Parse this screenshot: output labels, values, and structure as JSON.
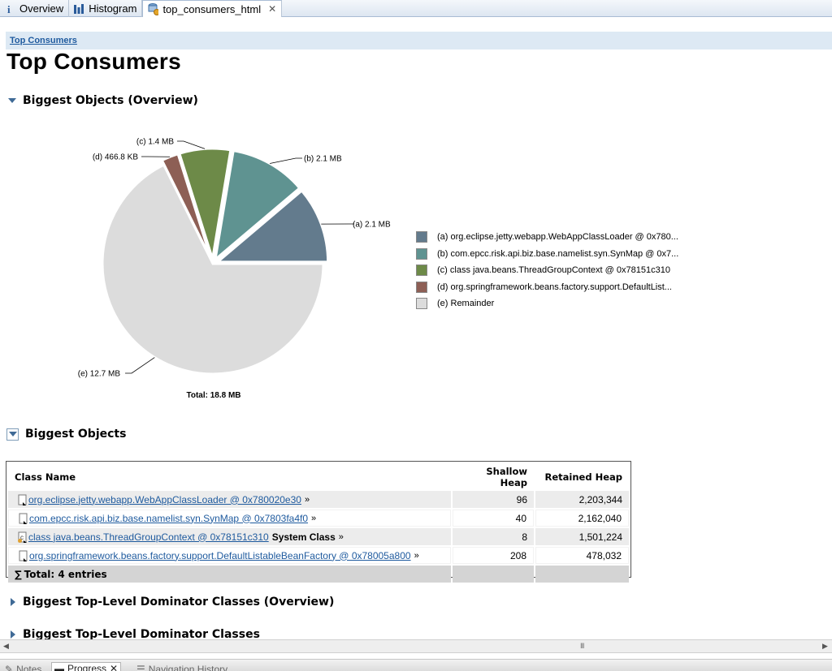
{
  "tabs": [
    {
      "label": "Overview",
      "icon": "info-icon"
    },
    {
      "label": "Histogram",
      "icon": "histogram-icon"
    },
    {
      "label": "top_consumers_html",
      "icon": "report-icon"
    }
  ],
  "breadcrumb": "Top Consumers",
  "page_title": "Top Consumers",
  "sections": {
    "overview_title": "Biggest Objects (Overview)",
    "objects_title": "Biggest Objects",
    "dominator_overview_title": "Biggest Top-Level Dominator Classes (Overview)",
    "dominator_title": "Biggest Top-Level Dominator Classes"
  },
  "chart_data": {
    "type": "pie",
    "title": "",
    "total_label": "Total: 18.8 MB",
    "slices": [
      {
        "key": "(a)",
        "label": "(a)  2.1 MB",
        "value": 2.1,
        "unit": "MB",
        "color": "#637b8d",
        "legend": "(a)  org.eclipse.jetty.webapp.WebAppClassLoader @ 0x780..."
      },
      {
        "key": "(b)",
        "label": "(b)  2.1 MB",
        "value": 2.1,
        "unit": "MB",
        "color": "#5f9391",
        "legend": "(b)  com.epcc.risk.api.biz.base.namelist.syn.SynMap @ 0x7..."
      },
      {
        "key": "(c)",
        "label": "(c)  1.4 MB",
        "value": 1.4,
        "unit": "MB",
        "color": "#6d8a48",
        "legend": "(c)  class java.beans.ThreadGroupContext @ 0x78151c310"
      },
      {
        "key": "(d)",
        "label": "(d)  466.8 KB",
        "value": 0.4668,
        "unit": "MB",
        "color": "#8d5f55",
        "legend": "(d)  org.springframework.beans.factory.support.DefaultList..."
      },
      {
        "key": "(e)",
        "label": "(e)  12.7 MB",
        "value": 12.7,
        "unit": "MB",
        "color": "#dcdcdc",
        "legend": "(e)  Remainder"
      }
    ]
  },
  "table": {
    "headers": {
      "class_name": "Class Name",
      "shallow": "Shallow Heap",
      "retained": "Retained Heap"
    },
    "rows": [
      {
        "name": "org.eclipse.jetty.webapp.WebAppClassLoader @ 0x780020e30",
        "suffix": "",
        "shallow": "96",
        "retained": "2,203,344",
        "icon": "object-icon"
      },
      {
        "name": "com.epcc.risk.api.biz.base.namelist.syn.SynMap @ 0x7803fa4f0",
        "suffix": "",
        "shallow": "40",
        "retained": "2,162,040",
        "icon": "object-icon"
      },
      {
        "name": "class java.beans.ThreadGroupContext @ 0x78151c310",
        "suffix": "System Class",
        "shallow": "8",
        "retained": "1,501,224",
        "icon": "class-icon"
      },
      {
        "name": "org.springframework.beans.factory.support.DefaultListableBeanFactory @ 0x78005a800",
        "suffix": "",
        "shallow": "208",
        "retained": "478,032",
        "icon": "object-icon"
      }
    ],
    "total": "Total: 4 entries",
    "chevron": "»"
  },
  "bottom_tabs": [
    {
      "label": "Notes"
    },
    {
      "label": "Progress"
    },
    {
      "label": "Navigation History"
    }
  ],
  "scroll": {
    "grip": "III"
  }
}
